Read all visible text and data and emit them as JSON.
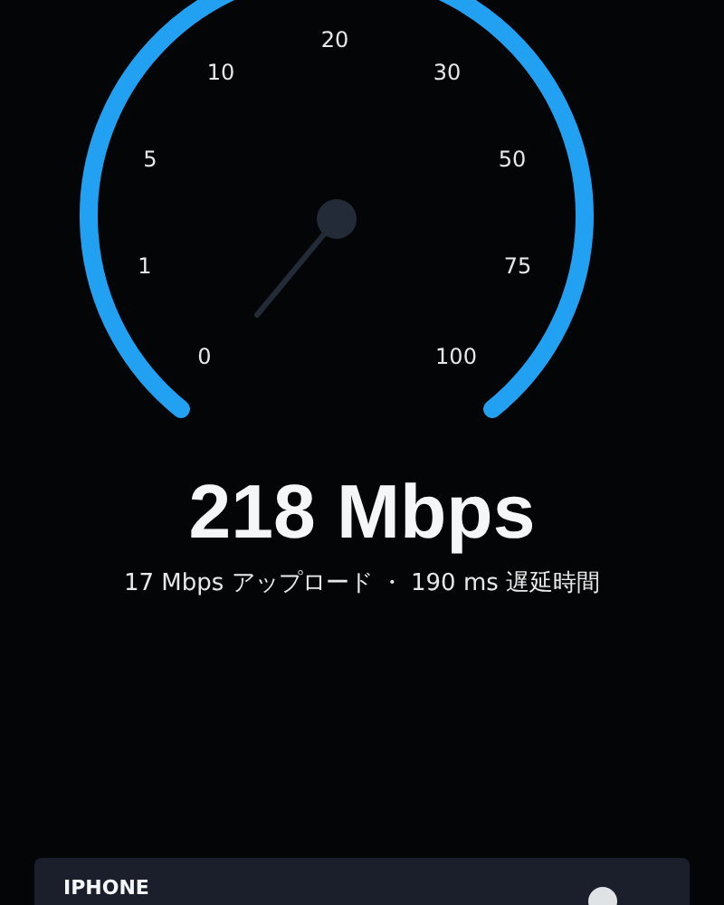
{
  "gauge": {
    "scale_labels": [
      "0",
      "1",
      "5",
      "10",
      "20",
      "30",
      "50",
      "75",
      "100"
    ]
  },
  "result": {
    "speed": "218 Mbps",
    "details": "17 Mbps アップロード ・ 190 ms 遅延時間"
  },
  "device_card": {
    "title": "IPHONE"
  }
}
